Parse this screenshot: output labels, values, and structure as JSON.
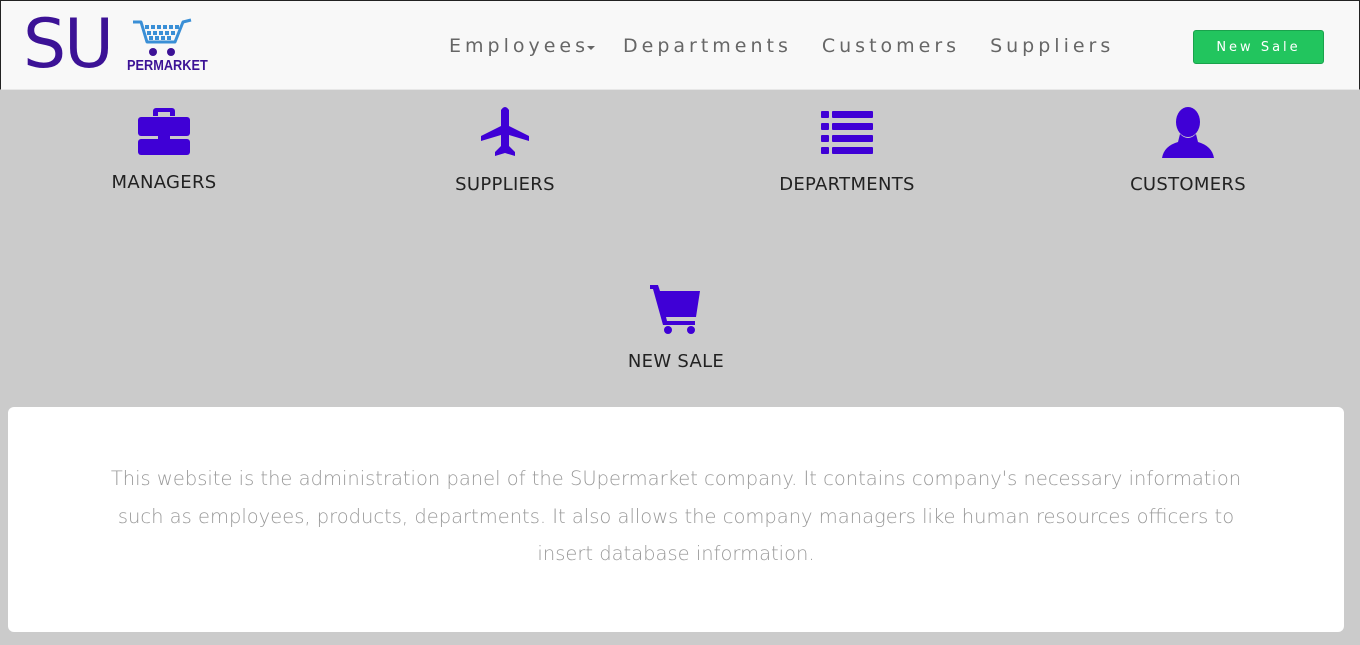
{
  "brand": {
    "logo_big": "SU",
    "logo_small": "PERMARKET",
    "primary_color": "#3c1296",
    "cart_color": "#3a8fd6"
  },
  "nav": {
    "employees": "Employees",
    "departments": "Departments",
    "customers": "Customers",
    "suppliers": "Suppliers",
    "new_sale": "New Sale",
    "new_sale_color": "#22c55e"
  },
  "tiles": {
    "icon_color": "#3f00d6",
    "managers": {
      "label": "MANAGERS",
      "icon": "briefcase-icon"
    },
    "suppliers": {
      "label": "SUPPLIERS",
      "icon": "plane-icon"
    },
    "departments": {
      "label": "DEPARTMENTS",
      "icon": "list-icon"
    },
    "customers": {
      "label": "CUSTOMERS",
      "icon": "user-icon"
    },
    "new_sale": {
      "label": "NEW SALE",
      "icon": "shopping-cart-icon"
    }
  },
  "info": {
    "text": "This website is the administration panel of the SUpermarket company. It contains company's necessary information such as employees, products, departments. It also allows the company managers like human resources officers to insert database information."
  }
}
